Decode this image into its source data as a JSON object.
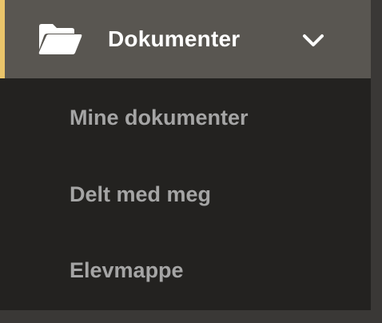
{
  "menu": {
    "header": {
      "icon": "folder-open-icon",
      "title": "Dokumenter",
      "toggle_icon": "chevron-down-icon",
      "accent_color": "#e9c46a",
      "background_color": "#595651"
    },
    "items": [
      {
        "label": "Mine dokumenter"
      },
      {
        "label": "Delt med meg"
      },
      {
        "label": "Elevmappe"
      }
    ],
    "panel_background_color": "#232220"
  }
}
